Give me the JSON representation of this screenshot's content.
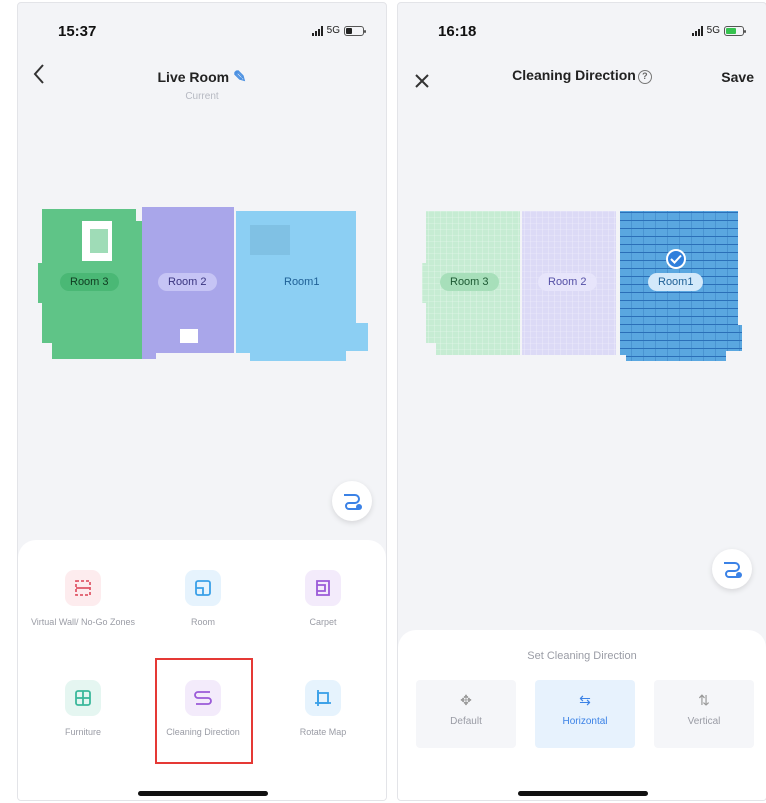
{
  "left_screen": {
    "status": {
      "time": "15:37",
      "network": "5G"
    },
    "nav": {
      "back_icon": "chevron-left-icon",
      "title": "Live Room",
      "subtitle": "Current"
    },
    "map": {
      "rooms": [
        {
          "label": "Room 3",
          "color": "#5fc487"
        },
        {
          "label": "Room 2",
          "color": "#a9a6ea"
        },
        {
          "label": "Room1",
          "color": "#8ccff3"
        }
      ]
    },
    "tools": [
      {
        "label": "Virtual Wall/ No-Go Zones",
        "icon": "virtual-wall-icon",
        "color": "#e05a6a"
      },
      {
        "label": "Room",
        "icon": "room-icon",
        "color": "#3aa0e8"
      },
      {
        "label": "Carpet",
        "icon": "carpet-icon",
        "color": "#9a5ad8"
      },
      {
        "label": "Furniture",
        "icon": "furniture-icon",
        "color": "#3bb89c"
      },
      {
        "label": "Cleaning Direction",
        "icon": "cleaning-direction-icon",
        "color": "#9a5ad8",
        "highlighted": true
      },
      {
        "label": "Rotate Map",
        "icon": "rotate-map-icon",
        "color": "#3aa0e8"
      }
    ]
  },
  "right_screen": {
    "status": {
      "time": "16:18",
      "network": "5G"
    },
    "nav": {
      "close_icon": "close-icon",
      "title": "Cleaning Direction",
      "save_label": "Save"
    },
    "map": {
      "rooms": [
        {
          "label": "Room 3",
          "color": "#c6ecd3"
        },
        {
          "label": "Room 2",
          "color": "#dcdaf6"
        },
        {
          "label": "Room1",
          "color": "#5aa7e0",
          "selected": true
        }
      ]
    },
    "direction_panel": {
      "title": "Set Cleaning Direction",
      "options": [
        {
          "label": "Default",
          "icon": "move-icon"
        },
        {
          "label": "Horizontal",
          "icon": "horizontal-arrows-icon",
          "selected": true
        },
        {
          "label": "Vertical",
          "icon": "vertical-arrows-icon"
        }
      ]
    }
  },
  "colors": {
    "accent": "#3b82e6",
    "highlight_box": "#e53935"
  }
}
